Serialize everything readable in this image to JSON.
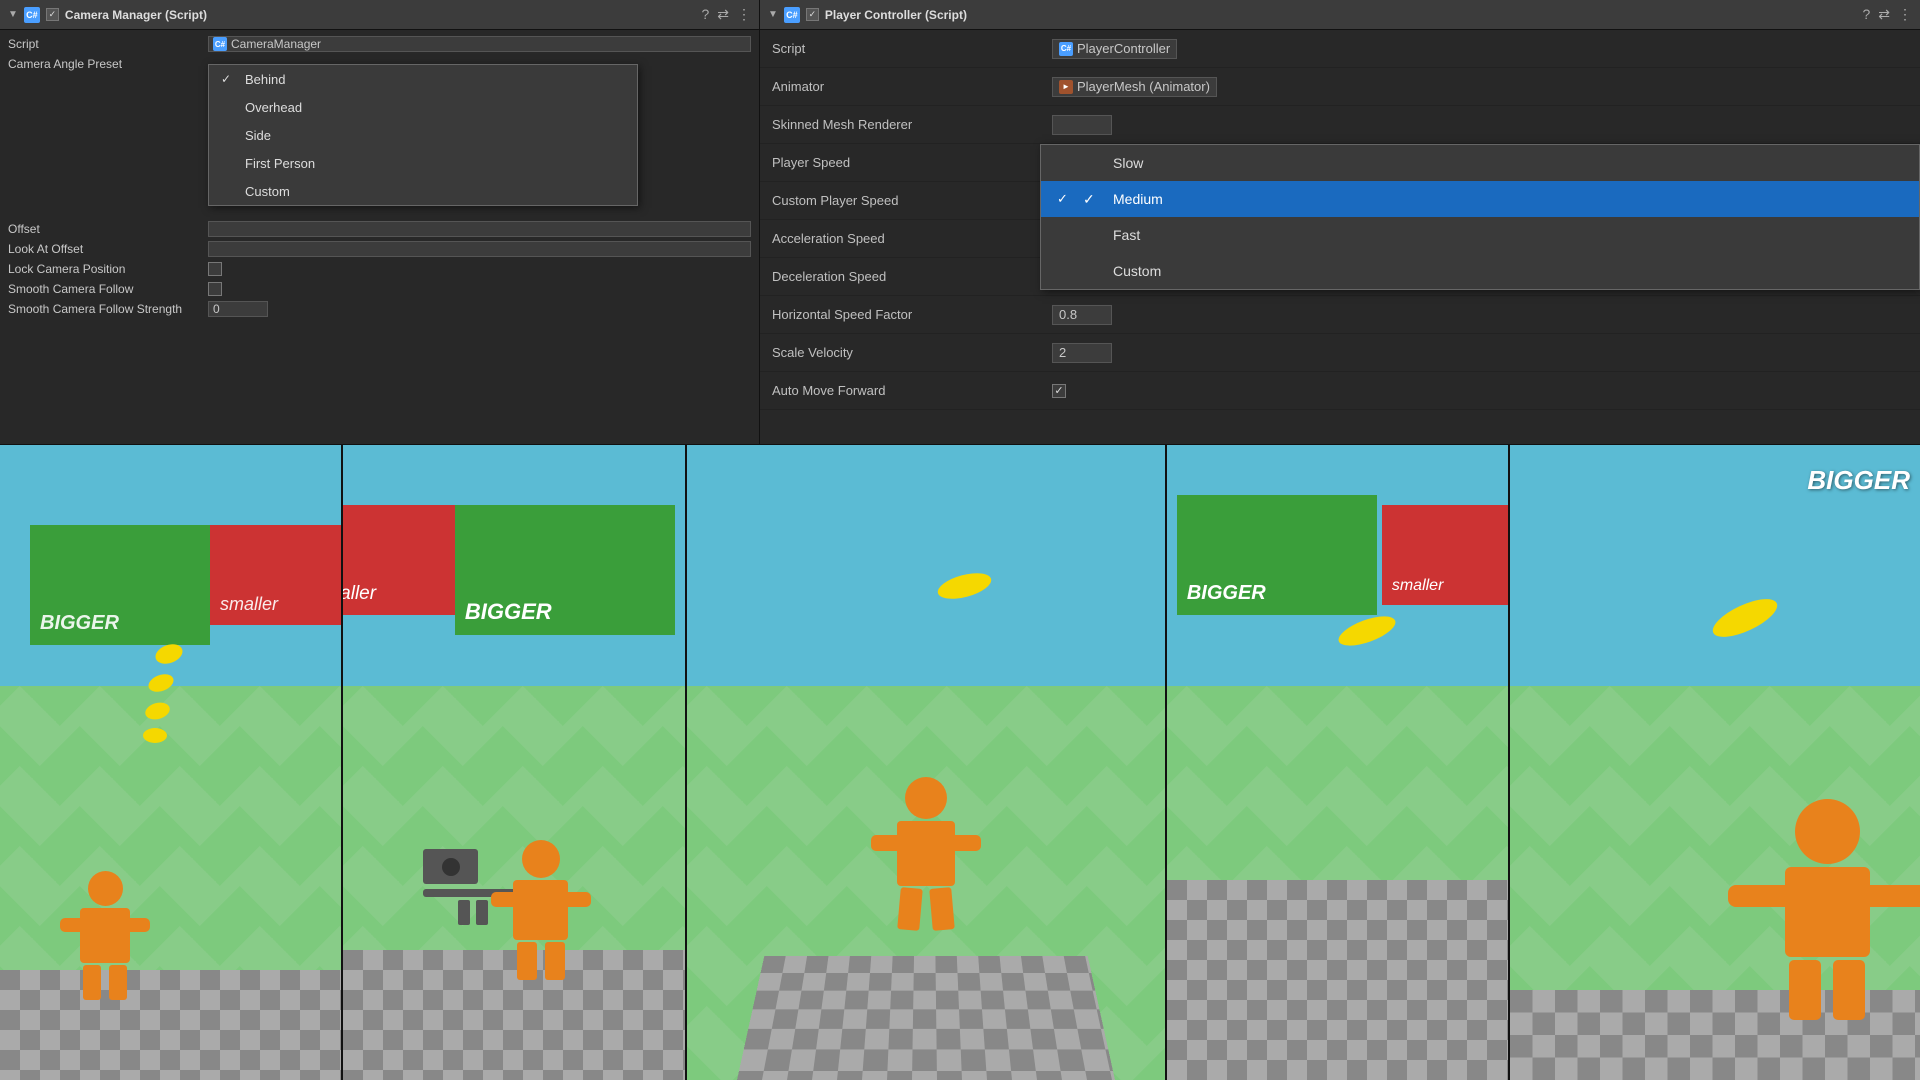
{
  "camera_panel": {
    "title": "Camera Manager (Script)",
    "script_ref": "CameraManager",
    "fields": [
      {
        "label": "Script",
        "value": "CameraManager",
        "type": "script"
      },
      {
        "label": "Camera Angle Preset",
        "value": "",
        "type": "dropdown"
      },
      {
        "label": "Offset",
        "value": "",
        "type": "vector"
      },
      {
        "label": "Look At Offset",
        "value": "",
        "type": "vector"
      },
      {
        "label": "Lock Camera Position",
        "value": "",
        "type": "checkbox"
      },
      {
        "label": "Smooth Camera Follow",
        "value": "",
        "type": "checkbox"
      },
      {
        "label": "Smooth Camera Follow Strength",
        "value": "0",
        "type": "number"
      }
    ],
    "dropdown_items": [
      {
        "label": "Behind",
        "checked": true
      },
      {
        "label": "Overhead",
        "checked": false
      },
      {
        "label": "Side",
        "checked": false
      },
      {
        "label": "First Person",
        "checked": false
      },
      {
        "label": "Custom",
        "checked": false
      }
    ]
  },
  "player_panel": {
    "title": "Player Controller (Script)",
    "script_ref": "PlayerController",
    "animator_ref": "PlayerMesh (Animator)",
    "fields": [
      {
        "label": "Script",
        "value": "PlayerController",
        "type": "script"
      },
      {
        "label": "Animator",
        "value": "PlayerMesh (Animator)",
        "type": "animator"
      },
      {
        "label": "Skinned Mesh Renderer",
        "value": "",
        "type": "ref"
      },
      {
        "label": "Player Speed",
        "value": "",
        "type": "dropdown"
      },
      {
        "label": "Custom Player Speed",
        "value": "",
        "type": "number"
      },
      {
        "label": "Acceleration Speed",
        "value": "",
        "type": "number"
      },
      {
        "label": "Deceleration Speed",
        "value": "",
        "type": "number"
      },
      {
        "label": "Horizontal Speed Factor",
        "value": "0.8",
        "type": "number"
      },
      {
        "label": "Scale Velocity",
        "value": "2",
        "type": "number"
      },
      {
        "label": "Auto Move Forward",
        "value": "true",
        "type": "checkbox"
      }
    ],
    "dropdown_items": [
      {
        "label": "Slow",
        "checked": false,
        "selected": false
      },
      {
        "label": "Medium",
        "checked": true,
        "selected": true
      },
      {
        "label": "Fast",
        "checked": false,
        "selected": false
      },
      {
        "label": "Custom",
        "checked": false,
        "selected": false
      }
    ]
  },
  "icons": {
    "checkmark": "✓",
    "script_c": "C#",
    "collapse": "▼",
    "link_arrow": "➔"
  },
  "colors": {
    "selected_blue": "#1a6abf",
    "header_bg": "#3c3c3c",
    "panel_bg": "#282828",
    "border": "#111",
    "text_main": "#c8c8c8",
    "text_dim": "#aaa"
  }
}
